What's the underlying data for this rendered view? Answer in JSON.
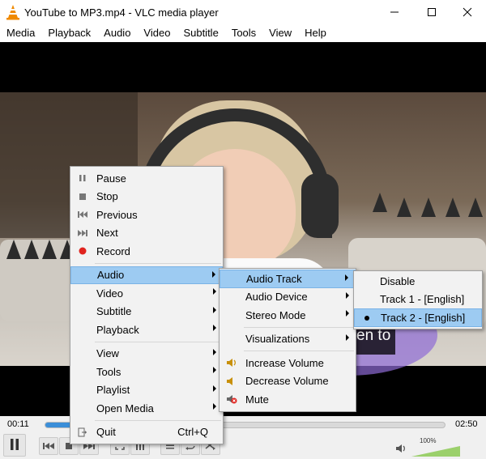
{
  "window": {
    "title": "YouTube to MP3.mp4 - VLC media player"
  },
  "menubar": [
    "Media",
    "Playback",
    "Audio",
    "Video",
    "Subtitle",
    "Tools",
    "View",
    "Help"
  ],
  "video": {
    "subtitle_text": "en to"
  },
  "controls": {
    "elapsed": "00:11",
    "total": "02:50",
    "progress": 0.07,
    "volume_percent": "100%",
    "volume_level": 1.0
  },
  "context_menu": {
    "pause": "Pause",
    "stop": "Stop",
    "previous": "Previous",
    "next": "Next",
    "record": "Record",
    "audio": "Audio",
    "video": "Video",
    "subtitle": "Subtitle",
    "playback": "Playback",
    "view": "View",
    "tools": "Tools",
    "playlist": "Playlist",
    "open_media": "Open Media",
    "quit": "Quit",
    "quit_shortcut": "Ctrl+Q"
  },
  "audio_menu": {
    "audio_track": "Audio Track",
    "audio_device": "Audio Device",
    "stereo_mode": "Stereo Mode",
    "visualizations": "Visualizations",
    "increase_volume": "Increase Volume",
    "decrease_volume": "Decrease Volume",
    "mute": "Mute"
  },
  "track_menu": {
    "disable": "Disable",
    "track1": "Track 1 - [English]",
    "track2": "Track 2 - [English]"
  },
  "colors": {
    "highlight": "#9dcbf2",
    "seek_fill": "#3b8ed8",
    "record_red": "#e0231e",
    "volume_green": "#9bd06b"
  }
}
